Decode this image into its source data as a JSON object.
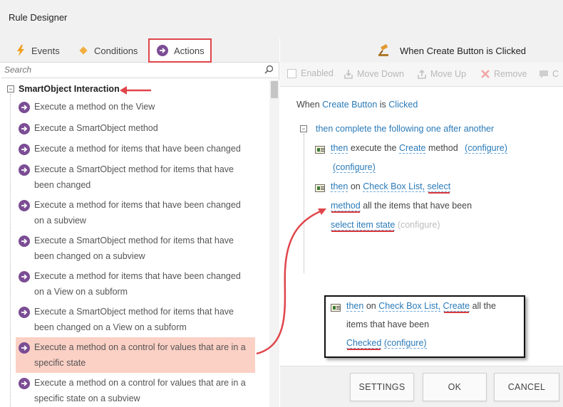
{
  "window": {
    "title": "Rule Designer"
  },
  "tabs": [
    {
      "label": "Events",
      "icon": "lightning-icon"
    },
    {
      "label": "Conditions",
      "icon": "diamond-icon"
    },
    {
      "label": "Actions",
      "icon": "arrow-circle-icon",
      "active": true
    }
  ],
  "search": {
    "placeholder": "Search"
  },
  "tree": {
    "category": "SmartObject Interaction",
    "items": [
      {
        "label": "Execute a method on the View"
      },
      {
        "label": "Execute a SmartObject method"
      },
      {
        "label": "Execute a method for items that have been changed"
      },
      {
        "label": "Execute a SmartObject method for items that have been changed"
      },
      {
        "label": "Execute a method for items that have been changed on a subview"
      },
      {
        "label": "Execute a SmartObject method for items that have been changed on a subview"
      },
      {
        "label": "Execute a method for items that have been changed on a View on a subform"
      },
      {
        "label": "Execute a SmartObject method for items that have been changed on a View on a subform"
      },
      {
        "label": "Execute a method on a control for values that are in a specific state",
        "highlighted": true
      },
      {
        "label": "Execute a method on a control for values that are in a specific state on a subview"
      }
    ]
  },
  "rule_header": {
    "title": "When Create Button is Clicked"
  },
  "toolbar": {
    "enabled": "Enabled",
    "move_down": "Move Down",
    "move_up": "Move Up",
    "remove": "Remove",
    "comment": "C"
  },
  "rule": {
    "when": "When",
    "control": "Create Button",
    "is": "is",
    "event": "Clicked",
    "group": "then complete the following one after another",
    "step1": {
      "then": "then",
      "execute_the": "execute the",
      "method_name": "Create",
      "method": "method",
      "configure1": "(configure)",
      "configure2": "(configure)"
    },
    "step2": {
      "then": "then",
      "on": "on",
      "control": "Check Box List,",
      "select": "select",
      "method": "method",
      "rest": "all the items that have been",
      "state": "select item state",
      "configure": "(configure)"
    },
    "step3": {
      "then": "then",
      "on": "on",
      "control": "Check Box List,",
      "method_name": "Create",
      "rest": "all the",
      "line2": "items that have been",
      "state": "Checked",
      "configure": "(configure)"
    }
  },
  "footer": {
    "settings": "SETTINGS",
    "ok": "OK",
    "cancel": "CANCEL"
  },
  "colors": {
    "highlight": "#fbd0c5",
    "annotation_red": "#e0454a",
    "link_blue": "#2a7ab8",
    "action_icon": "#7b4d94"
  }
}
